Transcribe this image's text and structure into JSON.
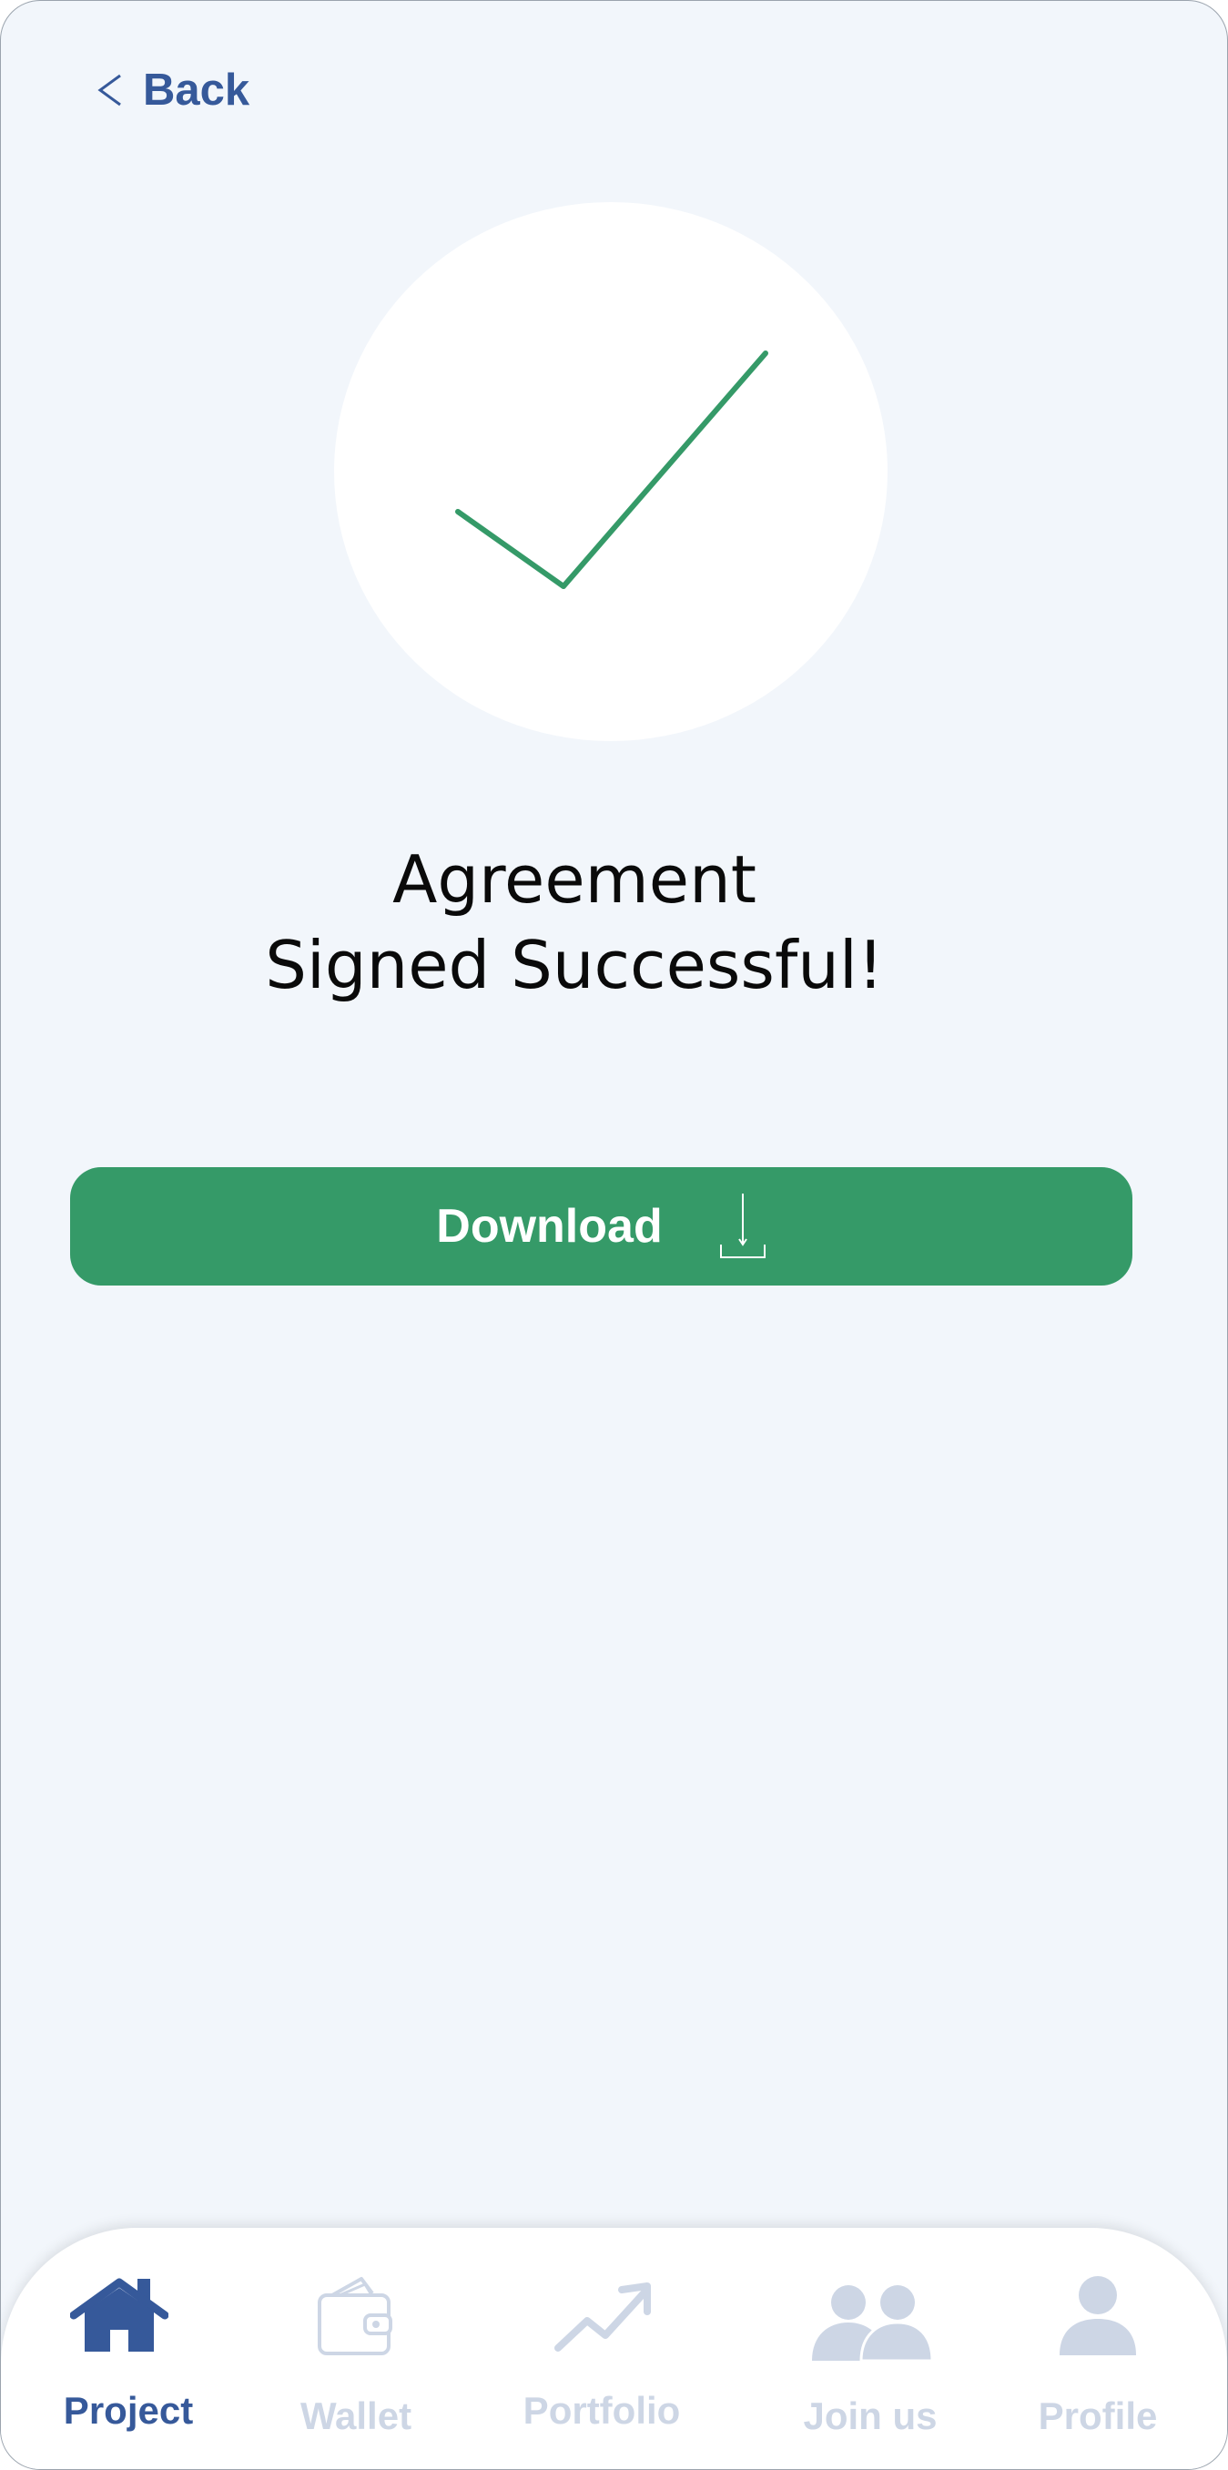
{
  "header": {
    "back_label": "Back",
    "back_icon": "chevron-left-icon"
  },
  "status": {
    "icon": "checkmark-icon",
    "title_line1": "Agreement",
    "title_line2": "Signed Successful!"
  },
  "actions": {
    "download_label": "Download",
    "download_icon": "download-icon"
  },
  "bottom_nav": {
    "items": [
      {
        "label": "Project",
        "icon": "home-icon",
        "active": true
      },
      {
        "label": "Wallet",
        "icon": "wallet-icon",
        "active": false
      },
      {
        "label": "Portfolio",
        "icon": "trending-up-icon",
        "active": false
      },
      {
        "label": "Join us",
        "icon": "users-icon",
        "active": false
      },
      {
        "label": "Profile",
        "icon": "user-icon",
        "active": false
      }
    ]
  },
  "colors": {
    "background": "#f2f6fb",
    "accent_blue": "#36599a",
    "success_green": "#359a68",
    "inactive_nav": "#cdd6e5",
    "text_dark": "#0a0a0a"
  }
}
